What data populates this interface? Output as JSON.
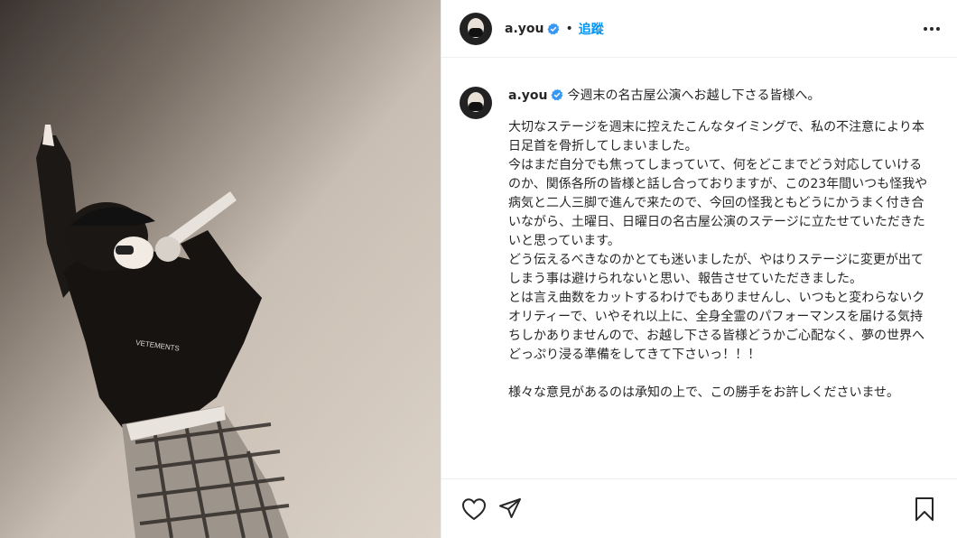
{
  "header": {
    "username": "a.you",
    "separator": "•",
    "follow_label": "追蹤"
  },
  "post": {
    "username": "a.you",
    "title": "今週末の名古屋公演へお越し下さる皆様へ。",
    "body": "大切なステージを週末に控えたこんなタイミングで、私の不注意により本日足首を骨折してしまいました。\n今はまだ自分でも焦ってしまっていて、何をどこまでどう対応していけるのか、関係各所の皆様と話し合っておりますが、この23年間いつも怪我や病気と二人三脚で進んで来たので、今回の怪我ともどうにかうまく付き合いながら、土曜日、日曜日の名古屋公演のステージに立たせていただきたいと思っています。\nどう伝えるべきなのかとても迷いましたが、やはりステージに変更が出てしまう事は避けられないと思い、報告させていただきました。\nとは言え曲数をカットするわけでもありませんし、いつもと変わらないクオリティーで、いやそれ以上に、全身全霊のパフォーマンスを届ける気持ちしかありませんので、お越し下さる皆様どうかご心配なく、夢の世界へどっぷり浸る準備をしてきて下さいっ！！！\n\n様々な意見があるのは承知の上で、この勝手をお許しくださいませ。"
  },
  "photo": {
    "shirt_text": "VETEMENTS"
  },
  "colors": {
    "accent": "#0095f6",
    "verified": "#3897f0",
    "text": "#262626",
    "border": "#efefef"
  },
  "icons": [
    "more-icon",
    "verified-badge-icon",
    "heart-icon",
    "share-icon",
    "bookmark-icon"
  ]
}
